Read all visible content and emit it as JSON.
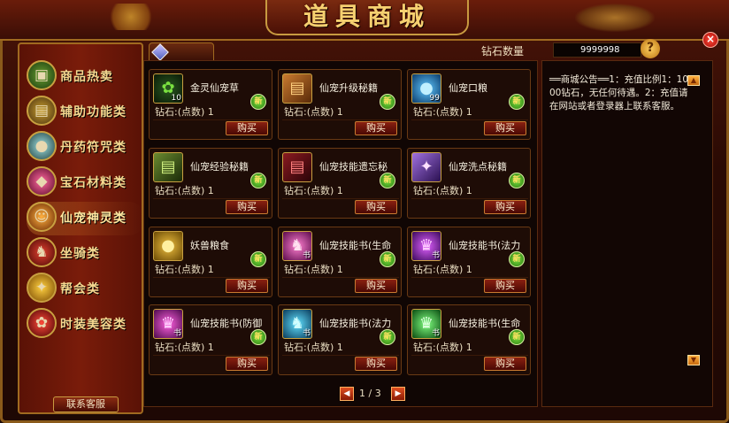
{
  "title": "道具商城",
  "close_label": "×",
  "diamond": {
    "label": "钻石数量",
    "value": "9999998"
  },
  "help_icon": "?",
  "sidebar": {
    "items": [
      {
        "label": "商品热卖",
        "icon": "box-icon"
      },
      {
        "label": "辅助功能类",
        "icon": "book-icon"
      },
      {
        "label": "丹药符咒类",
        "icon": "orb-icon"
      },
      {
        "label": "宝石材料类",
        "icon": "gem-icon"
      },
      {
        "label": "仙宠神灵类",
        "icon": "pet-icon"
      },
      {
        "label": "坐骑类",
        "icon": "horse-icon"
      },
      {
        "label": "帮会类",
        "icon": "guild-icon"
      },
      {
        "label": "时装美容类",
        "icon": "fashion-icon"
      }
    ],
    "contact_label": "联系客服"
  },
  "items": [
    {
      "name": "金灵仙宠草",
      "price": "钻石:(点数) 1",
      "qty": "10",
      "badge": "新",
      "buy": "购买"
    },
    {
      "name": "仙宠升级秘籍",
      "price": "钻石:(点数) 1",
      "qty": "",
      "badge": "新",
      "buy": "购买"
    },
    {
      "name": "仙宠口粮",
      "price": "钻石:(点数) 1",
      "qty": "99",
      "badge": "新",
      "buy": "购买"
    },
    {
      "name": "仙宠经验秘籍",
      "price": "钻石:(点数) 1",
      "qty": "",
      "badge": "新",
      "buy": "购买"
    },
    {
      "name": "仙宠技能遗忘秘",
      "price": "钻石:(点数) 1",
      "qty": "",
      "badge": "新",
      "buy": "购买"
    },
    {
      "name": "仙宠洗点秘籍",
      "price": "钻石:(点数) 1",
      "qty": "",
      "badge": "新",
      "buy": "购买"
    },
    {
      "name": "妖兽粮食",
      "price": "钻石:(点数) 1",
      "qty": "",
      "badge": "新",
      "buy": "购买"
    },
    {
      "name": "仙宠技能书(生命",
      "price": "钻石:(点数) 1",
      "qty": "书",
      "badge": "新",
      "buy": "购买"
    },
    {
      "name": "仙宠技能书(法力",
      "price": "钻石:(点数) 1",
      "qty": "书",
      "badge": "新",
      "buy": "购买"
    },
    {
      "name": "仙宠技能书(防御",
      "price": "钻石:(点数) 1",
      "qty": "书",
      "badge": "新",
      "buy": "购买"
    },
    {
      "name": "仙宠技能书(法力",
      "price": "钻石:(点数) 1",
      "qty": "书",
      "badge": "新",
      "buy": "购买"
    },
    {
      "name": "仙宠技能书(生命",
      "price": "钻石:(点数) 1",
      "qty": "书",
      "badge": "新",
      "buy": "购买"
    }
  ],
  "pager": {
    "prev": "◀",
    "text": "1 / 3",
    "next": "▶"
  },
  "notice": {
    "text": "══商城公告══1：充值比例1：1000钻石，无任何待遇。2：充值请在网站或者登录器上联系客服。",
    "up": "▲",
    "down": "▼"
  }
}
